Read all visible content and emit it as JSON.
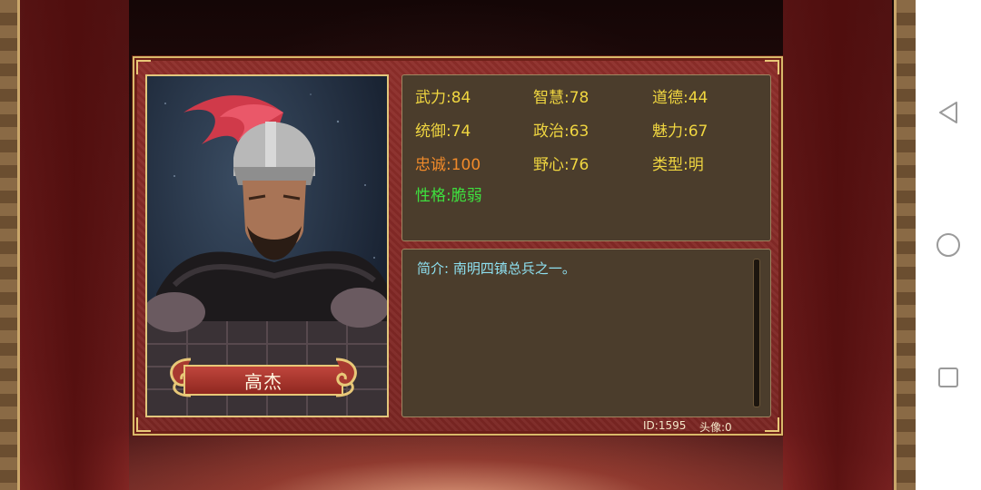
{
  "character": {
    "name": "高杰",
    "stats": [
      {
        "text": "武力:84",
        "color": "#f0d640"
      },
      {
        "text": "智慧:78",
        "color": "#f0d640"
      },
      {
        "text": "道德:44",
        "color": "#f0d640"
      },
      {
        "text": "统御:74",
        "color": "#f0d640"
      },
      {
        "text": "政治:63",
        "color": "#f0d640"
      },
      {
        "text": "魅力:67",
        "color": "#f0d640"
      },
      {
        "text": "忠诚:100",
        "color": "#f08a2a"
      },
      {
        "text": "野心:76",
        "color": "#f0d640"
      },
      {
        "text": "类型:明",
        "color": "#f0d640"
      },
      {
        "text": "性格:脆弱",
        "color": "#3ee03e"
      }
    ],
    "description": "简介: 南明四镇总兵之一。",
    "id_label": "ID:1595",
    "avatar_label": "头像:0"
  },
  "nav": {
    "back_icon": "back-triangle-icon",
    "home_icon": "home-circle-icon",
    "recents_icon": "recents-square-icon"
  },
  "colors": {
    "accent_gold": "#e8c878",
    "dialog_red": "#8e2e2a",
    "panel_brown": "#4b3d2c",
    "stat_yellow": "#f0d640",
    "loyalty_orange": "#f08a2a",
    "trait_green": "#3ee03e",
    "desc_cyan": "#8ee0f0"
  }
}
